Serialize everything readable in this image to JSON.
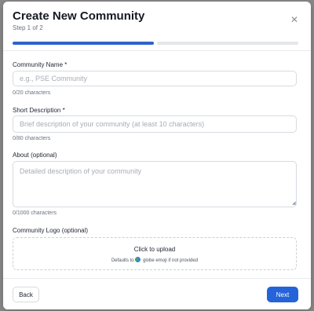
{
  "modal": {
    "title": "Create New Community",
    "step": "Step 1 of 2",
    "close_icon": "close-icon",
    "progress": {
      "current_step": 1,
      "total_steps": 2
    }
  },
  "form": {
    "name": {
      "label": "Community Name *",
      "placeholder": "e.g., PSE Community",
      "value": "",
      "counter": "0/20 characters"
    },
    "short_description": {
      "label": "Short Description *",
      "placeholder": "Brief description of your community (at least 10 characters)",
      "value": "",
      "counter": "0/80 characters"
    },
    "about": {
      "label": "About (optional)",
      "placeholder": "Detailed description of your community",
      "value": "",
      "counter": "0/1000 characters"
    },
    "logo": {
      "label": "Community Logo (optional)",
      "upload_text": "Click to upload",
      "default_prefix": "Defaults to",
      "default_icon": "globe-icon",
      "default_suffix": "globe emoji if not provided"
    }
  },
  "footer": {
    "back_label": "Back",
    "next_label": "Next"
  },
  "colors": {
    "accent": "#2563d8",
    "progress_fill": "#2e63c9",
    "progress_track": "#e3e6ea"
  }
}
